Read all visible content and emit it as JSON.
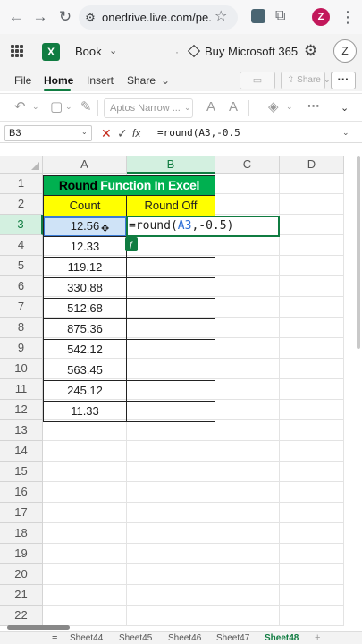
{
  "browser": {
    "url": "onedrive.live.com/pe...",
    "profile_initial": "Z",
    "icons": [
      "back-arrow-icon",
      "forward-arrow-icon",
      "reload-icon",
      "site-info-icon",
      "star-icon",
      "extension-icon",
      "puzzle-icon",
      "menu-icon"
    ]
  },
  "app": {
    "book_title": "Book",
    "buy_label": "Buy Microsoft 365",
    "account_initial": "Z",
    "logo_letter": "X",
    "brand_color": "#107c41"
  },
  "ribbon": {
    "tabs": [
      {
        "label": "File"
      },
      {
        "label": "Home"
      },
      {
        "label": "Insert"
      },
      {
        "label": "Share"
      }
    ],
    "share_label": "Share",
    "more_label": "···"
  },
  "toolbar": {
    "font_name": "Aptos Narrow ...",
    "more_label": "···"
  },
  "formula_bar": {
    "name_box": "B3",
    "fx_label": "fx",
    "formula": "=round(A3,-0.5"
  },
  "grid": {
    "columns": [
      "A",
      "B",
      "C",
      "D"
    ],
    "rows": [
      "1",
      "2",
      "3",
      "4",
      "5",
      "6",
      "7",
      "8",
      "9",
      "10",
      "11",
      "12",
      "13",
      "14",
      "15",
      "16",
      "17",
      "18",
      "19",
      "20",
      "21",
      "22"
    ],
    "title_word1": "Round",
    "title_rest": " Function In Excel",
    "header_count": "Count",
    "header_round_off": "Round Off",
    "values": [
      "12.56",
      "12.33",
      "119.12",
      "330.88",
      "512.68",
      "875.36",
      "542.12",
      "563.45",
      "245.12",
      "11.33"
    ],
    "edit_prefix": "=round(",
    "edit_ref": "A3",
    "edit_suffix": ",-0.5)",
    "title_fill": "#00b050",
    "header_fill": "#ffff00"
  },
  "sheets": {
    "tabs": [
      "Sheet44",
      "Sheet45",
      "Sheet46",
      "Sheet47",
      "Sheet48"
    ],
    "active": "Sheet48",
    "add_label": "+"
  }
}
